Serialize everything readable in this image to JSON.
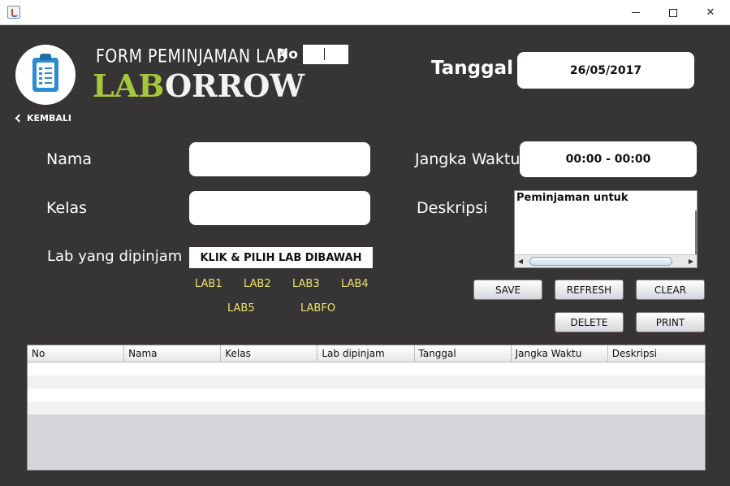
{
  "window": {
    "icons": {
      "app": "java-cup-icon",
      "minimize": "minimize-icon",
      "maximize": "maximize-icon",
      "close": "close-icon"
    }
  },
  "header": {
    "form_title": "FORM PEMINJAMAN LAB",
    "brand_part1": "LAB",
    "brand_part2": "ORROW",
    "logo_icon": "clipboard-checklist-icon",
    "no_label": "No",
    "no_value": "",
    "tanggal_label": "Tanggal",
    "tanggal_value": "26/05/2017",
    "back_label": "KEMBALI",
    "back_icon": "chevron-left-icon"
  },
  "form": {
    "nama_label": "Nama",
    "nama_value": "",
    "kelas_label": "Kelas",
    "kelas_value": "",
    "lab_label": "Lab yang dipinjam",
    "lab_value": "KLIK & PILIH LAB DIBAWAH",
    "lab_options": [
      "LAB1",
      "LAB2",
      "LAB3",
      "LAB4",
      "LAB5",
      "LABFO"
    ],
    "jangka_label": "Jangka Waktu",
    "jangka_value": "00:00 - 00:00",
    "deskripsi_label": "Deskripsi",
    "deskripsi_value": "Peminjaman untuk"
  },
  "buttons": {
    "save": "SAVE",
    "refresh": "REFRESH",
    "clear": "CLEAR",
    "delete": "DELETE",
    "print": "PRINT"
  },
  "table": {
    "columns": [
      "No",
      "Nama",
      "Kelas",
      "Lab dipinjam",
      "Tanggal",
      "Jangka Waktu",
      "Deskripsi"
    ],
    "rows": [
      [
        "",
        "",
        "",
        "",
        "",
        "",
        ""
      ],
      [
        "",
        "",
        "",
        "",
        "",
        "",
        ""
      ],
      [
        "",
        "",
        "",
        "",
        "",
        "",
        ""
      ],
      [
        "",
        "",
        "",
        "",
        "",
        "",
        ""
      ]
    ]
  },
  "colors": {
    "background": "#373435",
    "brand_green": "#a6c63b",
    "lab_option": "#e9e46a",
    "accent_blue": "#2b8ccf"
  }
}
